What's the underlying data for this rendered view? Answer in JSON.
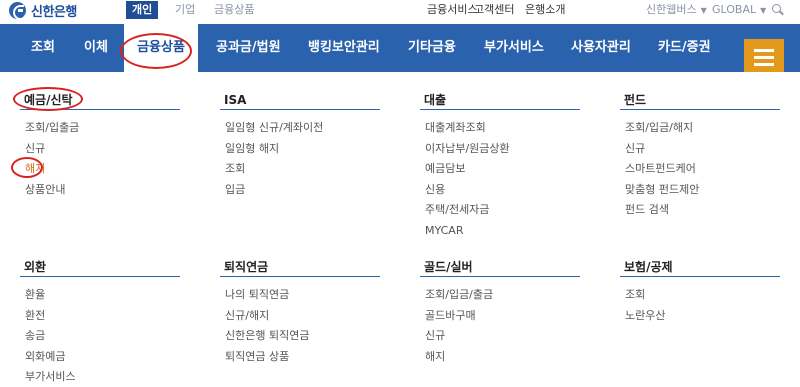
{
  "brand": {
    "name": "신한은행",
    "logo": "shinhan-logo-icon",
    "color": "#2a62ad"
  },
  "segments": [
    {
      "label": "개인",
      "active": true
    },
    {
      "label": "기업",
      "active": false
    },
    {
      "label": "금융상품",
      "active": false
    }
  ],
  "utility": {
    "links": [
      "금융서비스",
      "고객센터",
      "은행소개"
    ],
    "family": "신한웹버스",
    "language": "GLOBAL",
    "search_icon": "search-icon"
  },
  "nav": {
    "items": [
      "조회",
      "이체",
      "금융상품",
      "공과금/법원",
      "뱅킹보안관리",
      "기타금융",
      "부가서비스",
      "사용자관리",
      "카드/증권"
    ],
    "active_index": 2,
    "menu_icon": "hamburger-icon",
    "menu_color": "#e39a1c"
  },
  "mega_menu": {
    "sections": [
      {
        "title": "예금/신탁",
        "items": [
          "조회/입출금",
          "신규",
          "해지",
          "상품안내"
        ],
        "highlight_index": 2
      },
      {
        "title": "ISA",
        "items": [
          "일임형 신규/계좌이전",
          "일임형 해지",
          "조회",
          "입금"
        ]
      },
      {
        "title": "대출",
        "items": [
          "대출계좌조회",
          "이자납부/원금상환",
          "예금담보",
          "신용",
          "주택/전세자금",
          "MYCAR"
        ]
      },
      {
        "title": "펀드",
        "items": [
          "조회/입금/해지",
          "신규",
          "스마트펀드케어",
          "맞춤형 펀드제안",
          "펀드 검색"
        ]
      },
      {
        "title": "외환",
        "items": [
          "환율",
          "환전",
          "송금",
          "외화예금",
          "부가서비스"
        ]
      },
      {
        "title": "퇴직연금",
        "items": [
          "나의 퇴직연금",
          "신규/해지",
          "신한은행 퇴직연금",
          "퇴직연금 상품"
        ]
      },
      {
        "title": "골드/실버",
        "items": [
          "조회/입금/출금",
          "골드바구매",
          "신규",
          "해지"
        ]
      },
      {
        "title": "보험/공제",
        "items": [
          "조회",
          "노란우산"
        ]
      }
    ]
  },
  "annotation_color": "#d6231e",
  "highlight_color": "#d96a1e"
}
